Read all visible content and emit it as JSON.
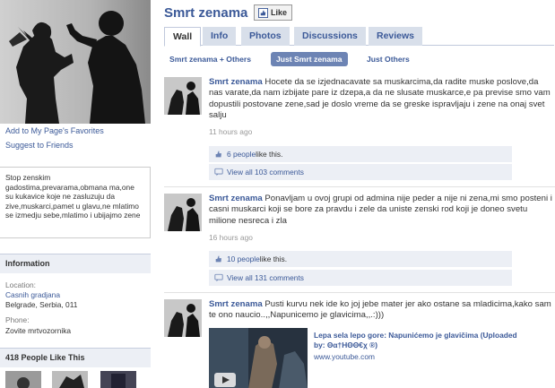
{
  "page": {
    "name": "Smrt zenama",
    "like_button": "Like"
  },
  "tabs": [
    "Wall",
    "Info",
    "Photos",
    "Discussions",
    "Reviews"
  ],
  "filters": [
    "Smrt zenama + Others",
    "Just Smrt zenama",
    "Just Others"
  ],
  "sidebar": {
    "add_favorites": "Add to My Page's Favorites",
    "suggest_friends": "Suggest to Friends",
    "bio": "Stop zenskim gadostima,prevarama,obmana ma,one su kukavice koje ne zasluzuju da zive,muskarci,pamet u glavu,ne mlatimo se izmedju sebe,mlatimo i ubijajmo zene",
    "information_title": "Information",
    "location_label": "Location:",
    "location_link": "Casnih gradjana",
    "location_text": "Belgrade, Serbia, 011",
    "phone_label": "Phone:",
    "phone_text": "Zovite mrtvozornika",
    "likes_title": "418 People Like This"
  },
  "posts": [
    {
      "author": "Smrt zenama",
      "text": " Hocete da se izjednacavate sa muskarcima,da radite muske poslove,da nas varate,da nam izbijate pare iz dzepa,a da ne slusate muskarce,e pa previse smo vam dopustili postovane zene,sad je doslo vreme da se greske ispravljaju i zene na onaj svet salju",
      "time": "11 hours ago",
      "likes_link": "6 people",
      "likes_suffix": " like this.",
      "comments": "View all 103 comments"
    },
    {
      "author": "Smrt zenama",
      "text": " Ponavljam u ovoj grupi od admina nije peder a nije ni zena,mi smo posteni i casni muskarci koji se bore za pravdu i zele da uniste zenski rod koji je doneo svetu milione nesreca i zla",
      "time": "16 hours ago",
      "likes_link": "10 people",
      "likes_suffix": " like this.",
      "comments": "View all 131 comments"
    },
    {
      "author": "Smrt zenama",
      "text": " Pusti kurvu nek ide ko joj jebe mater jer ako ostane sa mladicima,kako sam te ono naucio..,,Napunicemo je glavicima,,.:)))",
      "video_title": "Lepa sela lepo gore: Napunićemo je glavičima (Uploaded by: Θα†ΗΘΘ€χ ®)",
      "video_url": "www.youtube.com"
    }
  ],
  "colors": {
    "brand": "#3b5998",
    "tab_bg": "#d8dfea",
    "bar_bg": "#eceff5",
    "filter_active": "#6d84b4"
  },
  "icons": [
    "thumbs-up-icon",
    "comment-icon",
    "play-icon"
  ]
}
